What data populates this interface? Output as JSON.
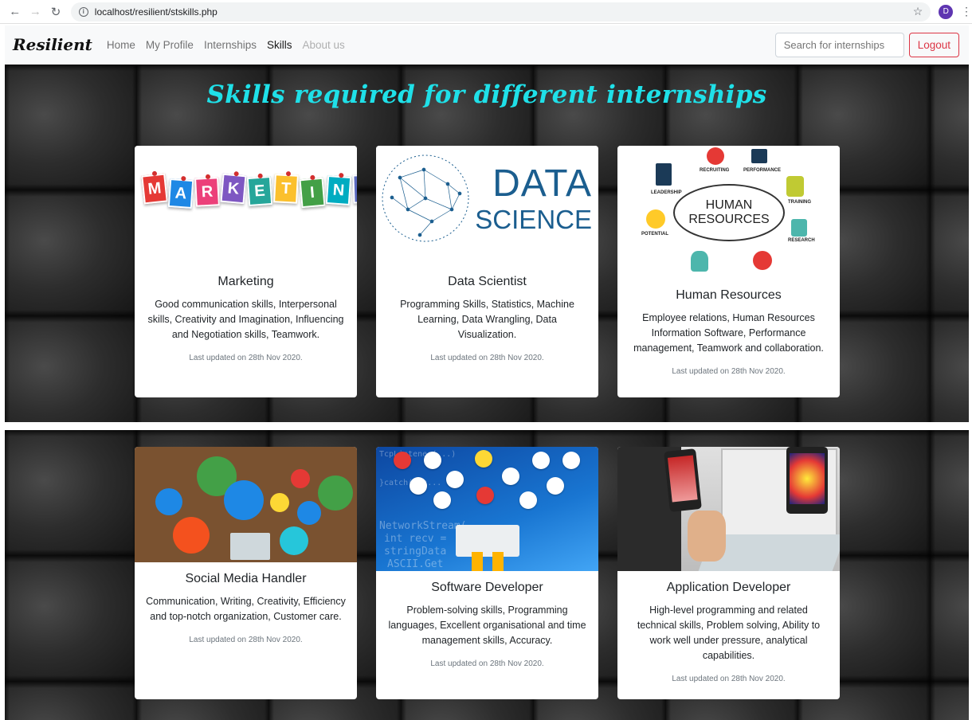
{
  "browser": {
    "url": "localhost/resilient/stskills.php",
    "profile_initial": "D"
  },
  "navbar": {
    "brand": "Resilient",
    "links": [
      "Home",
      "My Profile",
      "Internships",
      "Skills",
      "About us"
    ],
    "search_placeholder": "Search for internships",
    "logout_label": "Logout"
  },
  "page": {
    "title": "Skills required for different internships"
  },
  "images": {
    "marketing_letters": [
      "M",
      "A",
      "R",
      "K",
      "E",
      "T",
      "I",
      "N",
      "G"
    ],
    "data_science_line1": "DATA",
    "data_science_line2": "SCIENCE",
    "hr_line1": "HUMAN",
    "hr_line2": "RESOURCES",
    "hr_labels": [
      "RECRUITING",
      "PERFORMANCE",
      "LEADERSHIP",
      "TRAINING",
      "POTENTIAL",
      "RESEARCH"
    ]
  },
  "cards": [
    {
      "title": "Marketing",
      "text": "Good communication skills, Interpersonal skills, Creativity and Imagination, Influencing and Negotiation skills, Teamwork.",
      "updated": "Last updated on 28th Nov 2020."
    },
    {
      "title": "Data Scientist",
      "text": "Programming Skills, Statistics, Machine Learning, Data Wrangling, Data Visualization.",
      "updated": "Last updated on 28th Nov 2020."
    },
    {
      "title": "Human Resources",
      "text": "Employee relations, Human Resources Information Software, Performance management, Teamwork and collaboration.",
      "updated": "Last updated on 28th Nov 2020."
    },
    {
      "title": "Social Media Handler",
      "text": "Communication, Writing, Creativity, Efficiency and top-notch organization, Customer care.",
      "updated": "Last updated on 28th Nov 2020."
    },
    {
      "title": "Software Developer",
      "text": "Problem-solving skills, Programming languages, Excellent organisational and time management skills, Accuracy.",
      "updated": "Last updated on 28th Nov 2020."
    },
    {
      "title": "Application Developer",
      "text": "High-level programming and related technical skills, Problem solving, Ability to work well under pressure, analytical capabilities.",
      "updated": "Last updated on 28th Nov 2020."
    }
  ]
}
